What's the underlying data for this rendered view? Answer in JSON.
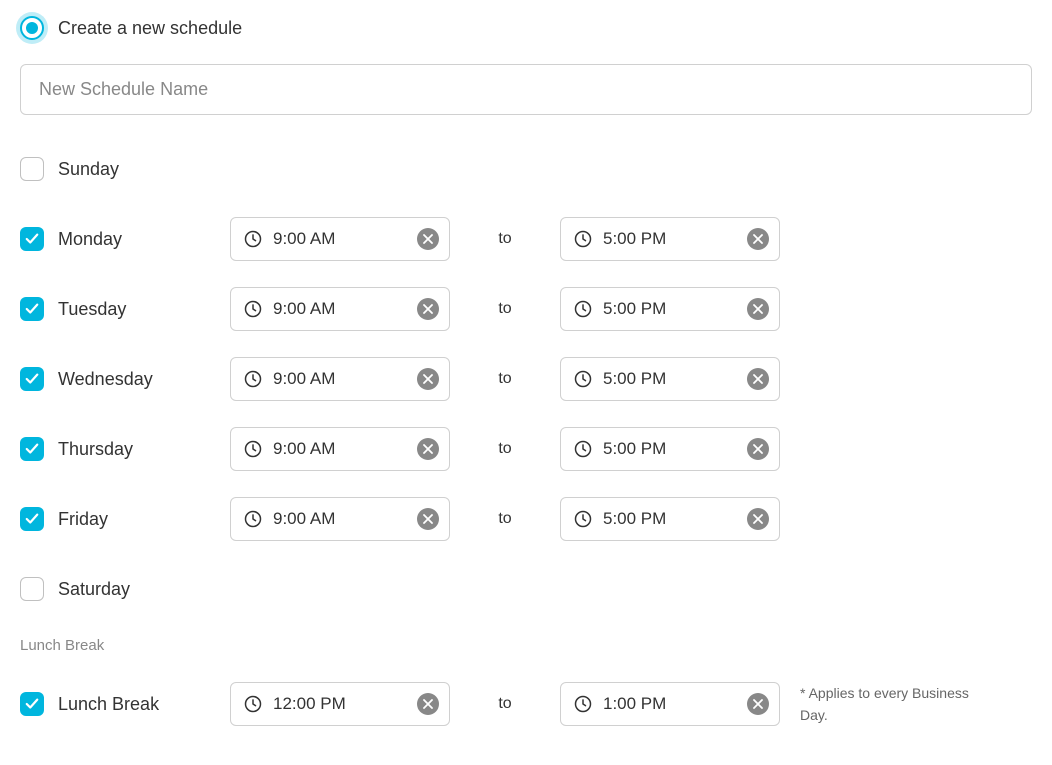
{
  "create_option": {
    "label": "Create a new schedule",
    "selected": true
  },
  "schedule_name": {
    "placeholder": "New Schedule Name",
    "value": ""
  },
  "separator_label": "to",
  "days": [
    {
      "name": "Sunday",
      "checked": false,
      "start": "",
      "end": ""
    },
    {
      "name": "Monday",
      "checked": true,
      "start": "9:00 AM",
      "end": "5:00 PM"
    },
    {
      "name": "Tuesday",
      "checked": true,
      "start": "9:00 AM",
      "end": "5:00 PM"
    },
    {
      "name": "Wednesday",
      "checked": true,
      "start": "9:00 AM",
      "end": "5:00 PM"
    },
    {
      "name": "Thursday",
      "checked": true,
      "start": "9:00 AM",
      "end": "5:00 PM"
    },
    {
      "name": "Friday",
      "checked": true,
      "start": "9:00 AM",
      "end": "5:00 PM"
    },
    {
      "name": "Saturday",
      "checked": false,
      "start": "",
      "end": ""
    }
  ],
  "lunch": {
    "heading": "Lunch Break",
    "label": "Lunch Break",
    "checked": true,
    "start": "12:00 PM",
    "end": "1:00 PM",
    "footnote": "* Applies to every Business Day."
  }
}
